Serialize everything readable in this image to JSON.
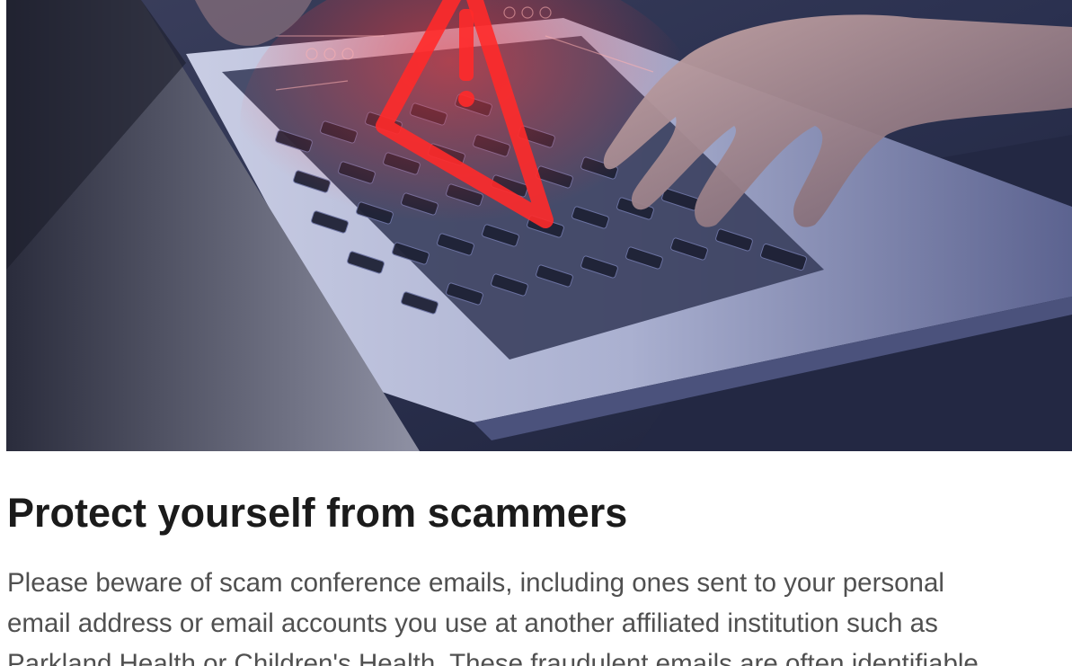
{
  "hero": {
    "icon": "warning-triangle-icon",
    "accent_color": "#ff2a2a"
  },
  "article": {
    "title": "Protect yourself from scammers",
    "lines": [
      "Please beware of scam conference emails, including ones sent to your personal",
      "email address or email accounts you use at another affiliated institution such as",
      "Parkland Health or Children's Health. These fraudulent emails are often identifiable"
    ]
  }
}
